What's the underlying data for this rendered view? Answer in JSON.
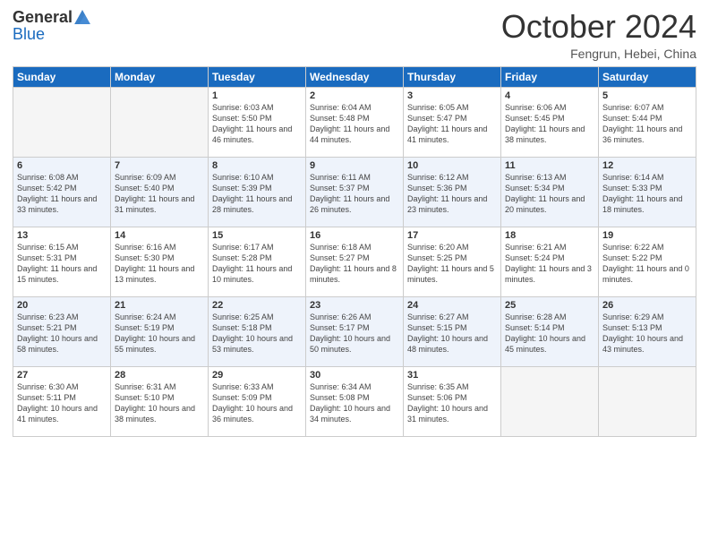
{
  "header": {
    "logo_general": "General",
    "logo_blue": "Blue",
    "title": "October 2024",
    "location": "Fengrun, Hebei, China"
  },
  "days_of_week": [
    "Sunday",
    "Monday",
    "Tuesday",
    "Wednesday",
    "Thursday",
    "Friday",
    "Saturday"
  ],
  "weeks": [
    [
      {
        "day": "",
        "info": ""
      },
      {
        "day": "",
        "info": ""
      },
      {
        "day": "1",
        "info": "Sunrise: 6:03 AM\nSunset: 5:50 PM\nDaylight: 11 hours and 46 minutes."
      },
      {
        "day": "2",
        "info": "Sunrise: 6:04 AM\nSunset: 5:48 PM\nDaylight: 11 hours and 44 minutes."
      },
      {
        "day": "3",
        "info": "Sunrise: 6:05 AM\nSunset: 5:47 PM\nDaylight: 11 hours and 41 minutes."
      },
      {
        "day": "4",
        "info": "Sunrise: 6:06 AM\nSunset: 5:45 PM\nDaylight: 11 hours and 38 minutes."
      },
      {
        "day": "5",
        "info": "Sunrise: 6:07 AM\nSunset: 5:44 PM\nDaylight: 11 hours and 36 minutes."
      }
    ],
    [
      {
        "day": "6",
        "info": "Sunrise: 6:08 AM\nSunset: 5:42 PM\nDaylight: 11 hours and 33 minutes."
      },
      {
        "day": "7",
        "info": "Sunrise: 6:09 AM\nSunset: 5:40 PM\nDaylight: 11 hours and 31 minutes."
      },
      {
        "day": "8",
        "info": "Sunrise: 6:10 AM\nSunset: 5:39 PM\nDaylight: 11 hours and 28 minutes."
      },
      {
        "day": "9",
        "info": "Sunrise: 6:11 AM\nSunset: 5:37 PM\nDaylight: 11 hours and 26 minutes."
      },
      {
        "day": "10",
        "info": "Sunrise: 6:12 AM\nSunset: 5:36 PM\nDaylight: 11 hours and 23 minutes."
      },
      {
        "day": "11",
        "info": "Sunrise: 6:13 AM\nSunset: 5:34 PM\nDaylight: 11 hours and 20 minutes."
      },
      {
        "day": "12",
        "info": "Sunrise: 6:14 AM\nSunset: 5:33 PM\nDaylight: 11 hours and 18 minutes."
      }
    ],
    [
      {
        "day": "13",
        "info": "Sunrise: 6:15 AM\nSunset: 5:31 PM\nDaylight: 11 hours and 15 minutes."
      },
      {
        "day": "14",
        "info": "Sunrise: 6:16 AM\nSunset: 5:30 PM\nDaylight: 11 hours and 13 minutes."
      },
      {
        "day": "15",
        "info": "Sunrise: 6:17 AM\nSunset: 5:28 PM\nDaylight: 11 hours and 10 minutes."
      },
      {
        "day": "16",
        "info": "Sunrise: 6:18 AM\nSunset: 5:27 PM\nDaylight: 11 hours and 8 minutes."
      },
      {
        "day": "17",
        "info": "Sunrise: 6:20 AM\nSunset: 5:25 PM\nDaylight: 11 hours and 5 minutes."
      },
      {
        "day": "18",
        "info": "Sunrise: 6:21 AM\nSunset: 5:24 PM\nDaylight: 11 hours and 3 minutes."
      },
      {
        "day": "19",
        "info": "Sunrise: 6:22 AM\nSunset: 5:22 PM\nDaylight: 11 hours and 0 minutes."
      }
    ],
    [
      {
        "day": "20",
        "info": "Sunrise: 6:23 AM\nSunset: 5:21 PM\nDaylight: 10 hours and 58 minutes."
      },
      {
        "day": "21",
        "info": "Sunrise: 6:24 AM\nSunset: 5:19 PM\nDaylight: 10 hours and 55 minutes."
      },
      {
        "day": "22",
        "info": "Sunrise: 6:25 AM\nSunset: 5:18 PM\nDaylight: 10 hours and 53 minutes."
      },
      {
        "day": "23",
        "info": "Sunrise: 6:26 AM\nSunset: 5:17 PM\nDaylight: 10 hours and 50 minutes."
      },
      {
        "day": "24",
        "info": "Sunrise: 6:27 AM\nSunset: 5:15 PM\nDaylight: 10 hours and 48 minutes."
      },
      {
        "day": "25",
        "info": "Sunrise: 6:28 AM\nSunset: 5:14 PM\nDaylight: 10 hours and 45 minutes."
      },
      {
        "day": "26",
        "info": "Sunrise: 6:29 AM\nSunset: 5:13 PM\nDaylight: 10 hours and 43 minutes."
      }
    ],
    [
      {
        "day": "27",
        "info": "Sunrise: 6:30 AM\nSunset: 5:11 PM\nDaylight: 10 hours and 41 minutes."
      },
      {
        "day": "28",
        "info": "Sunrise: 6:31 AM\nSunset: 5:10 PM\nDaylight: 10 hours and 38 minutes."
      },
      {
        "day": "29",
        "info": "Sunrise: 6:33 AM\nSunset: 5:09 PM\nDaylight: 10 hours and 36 minutes."
      },
      {
        "day": "30",
        "info": "Sunrise: 6:34 AM\nSunset: 5:08 PM\nDaylight: 10 hours and 34 minutes."
      },
      {
        "day": "31",
        "info": "Sunrise: 6:35 AM\nSunset: 5:06 PM\nDaylight: 10 hours and 31 minutes."
      },
      {
        "day": "",
        "info": ""
      },
      {
        "day": "",
        "info": ""
      }
    ]
  ]
}
